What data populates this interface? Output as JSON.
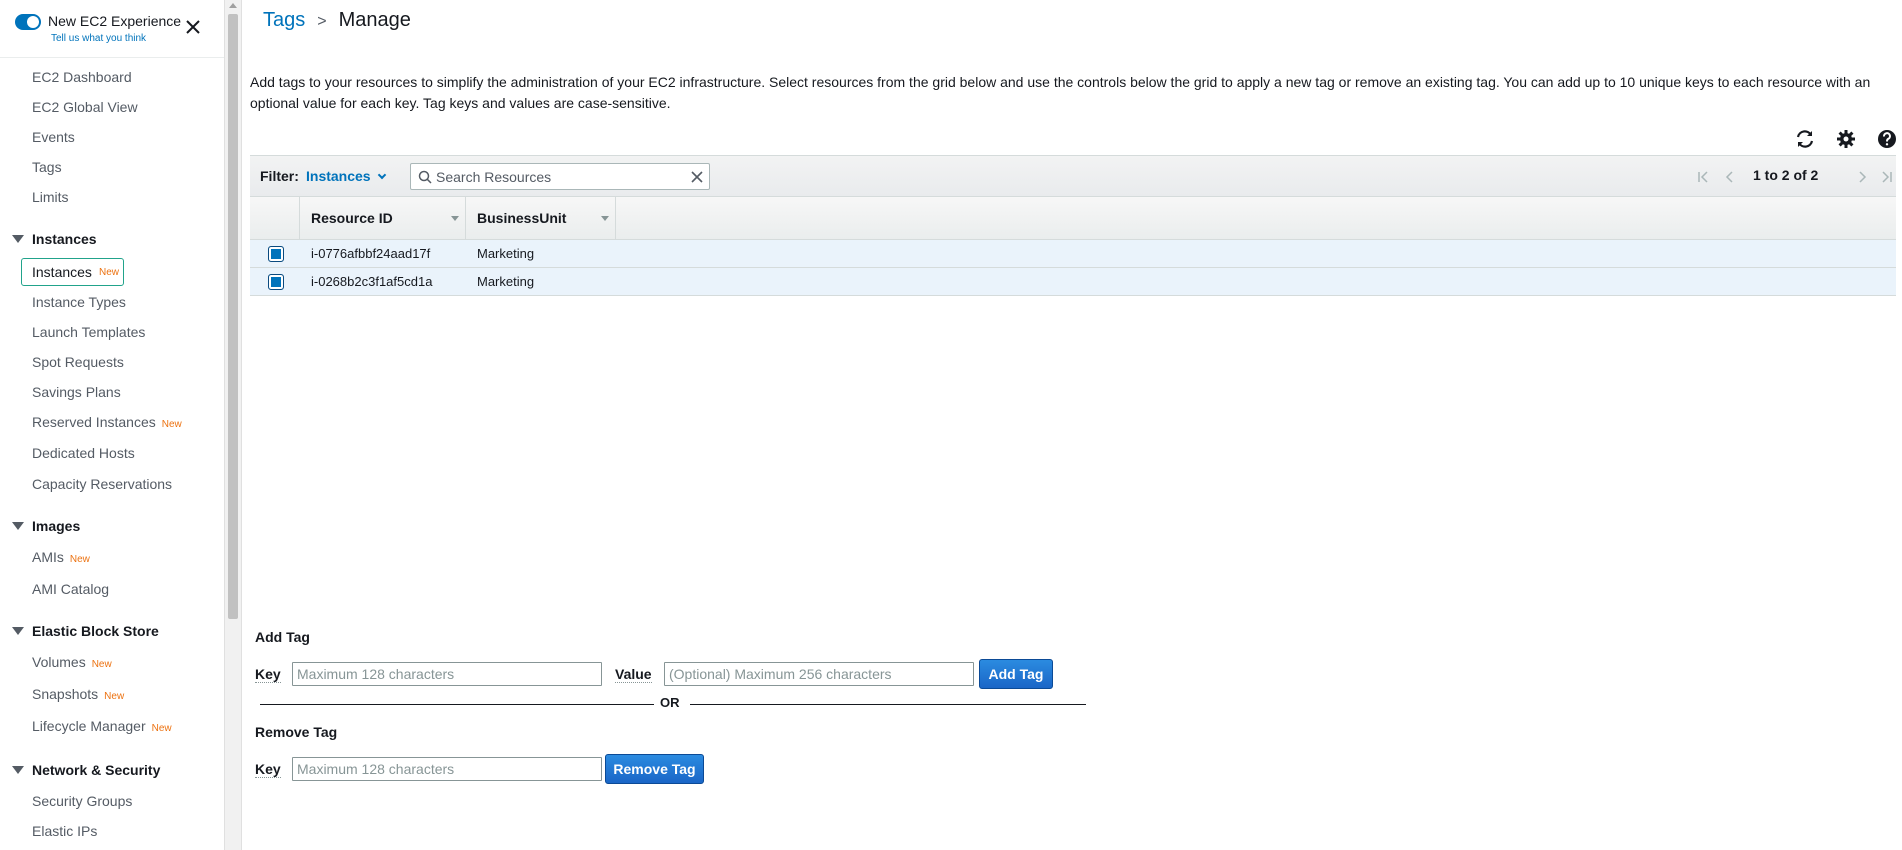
{
  "experience": {
    "title": "New EC2 Experience",
    "feedback_link": "Tell us what you think"
  },
  "sidebar": {
    "top_items": [
      {
        "label": "EC2 Dashboard"
      },
      {
        "label": "EC2 Global View"
      },
      {
        "label": "Events"
      },
      {
        "label": "Tags"
      },
      {
        "label": "Limits"
      }
    ],
    "sections": {
      "instances": {
        "title": "Instances",
        "items": [
          {
            "label": "Instances",
            "badge": "New"
          },
          {
            "label": "Instance Types"
          },
          {
            "label": "Launch Templates"
          },
          {
            "label": "Spot Requests"
          },
          {
            "label": "Savings Plans"
          },
          {
            "label": "Reserved Instances",
            "badge": "New"
          },
          {
            "label": "Dedicated Hosts"
          },
          {
            "label": "Capacity Reservations"
          }
        ]
      },
      "images": {
        "title": "Images",
        "items": [
          {
            "label": "AMIs",
            "badge": "New"
          },
          {
            "label": "AMI Catalog"
          }
        ]
      },
      "ebs": {
        "title": "Elastic Block Store",
        "items": [
          {
            "label": "Volumes",
            "badge": "New"
          },
          {
            "label": "Snapshots",
            "badge": "New"
          },
          {
            "label": "Lifecycle Manager",
            "badge": "New"
          }
        ]
      },
      "network": {
        "title": "Network & Security",
        "items": [
          {
            "label": "Security Groups"
          },
          {
            "label": "Elastic IPs"
          }
        ]
      }
    }
  },
  "breadcrumb": {
    "parent": "Tags",
    "separator": ">",
    "current": "Manage"
  },
  "description": "Add tags to your resources to simplify the administration of your EC2 infrastructure. Select resources from the grid below and use the controls below the grid to apply a new tag or remove an existing tag. You can add up to 10 unique keys to each resource with an optional value for each key. Tag keys and values are case-sensitive.",
  "toolbar": {
    "icons": [
      "refresh-icon",
      "settings-icon",
      "help-icon"
    ]
  },
  "filter": {
    "label": "Filter:",
    "selected": "Instances",
    "search_placeholder": "Search Resources",
    "pagination": "1 to 2 of 2"
  },
  "grid": {
    "columns": [
      "Resource ID",
      "BusinessUnit"
    ],
    "rows": [
      {
        "resource_id": "i-0776afbbf24aad17f",
        "business_unit": "Marketing",
        "selected": true
      },
      {
        "resource_id": "i-0268b2c3f1af5cd1a",
        "business_unit": "Marketing",
        "selected": true
      }
    ]
  },
  "add_tag": {
    "title": "Add Tag",
    "key_label": "Key",
    "key_placeholder": "Maximum 128 characters",
    "value_label": "Value",
    "value_placeholder": "(Optional) Maximum 256 characters",
    "button": "Add Tag"
  },
  "divider_text": "OR",
  "remove_tag": {
    "title": "Remove Tag",
    "key_label": "Key",
    "key_placeholder": "Maximum 128 characters",
    "button": "Remove Tag"
  },
  "colors": {
    "link": "#0073bb",
    "badge": "#ec7211",
    "primary_button": "#1f6fd1",
    "selected_row": "#eaf3fb",
    "active_nav_border": "#21a38b"
  }
}
